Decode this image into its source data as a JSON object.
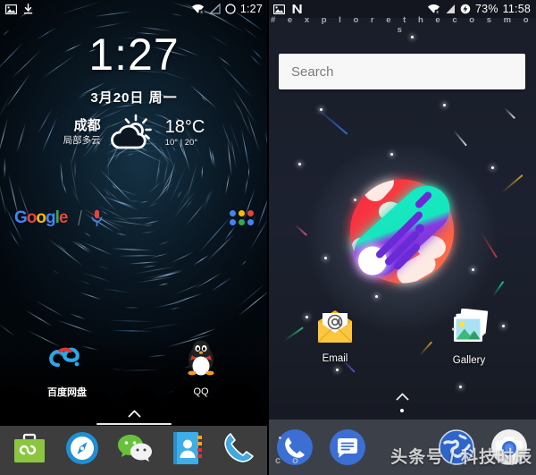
{
  "left_phone": {
    "status_bar": {
      "icons": [
        "image-icon",
        "download-icon"
      ],
      "wifi_icon": "wifi-off-icon",
      "signal_icon": "signal-no-service-icon",
      "battery_icon": "battery-empty-icon",
      "time": "1:27"
    },
    "clock_widget": {
      "time": "1:27",
      "date": "3月20日 周一",
      "weather": {
        "city": "成都",
        "condition": "局部多云",
        "icon": "partly-cloudy-icon",
        "temperature": "18°C",
        "range": "10° | 20°"
      }
    },
    "google_bar": {
      "logo": "Google",
      "logo_letters": [
        "G",
        "o",
        "o",
        "g",
        "l",
        "e"
      ],
      "mic_icon": "microphone-icon",
      "apps_icon": "colored-dots-grid-icon"
    },
    "home_apps": [
      {
        "label": "百度网盘",
        "icon": "baidu-netdisk-icon"
      },
      {
        "label": "QQ",
        "icon": "qq-penguin-icon"
      }
    ],
    "page_arrow": "^",
    "dock": [
      {
        "label": "Briefcase App",
        "icon": "green-briefcase-icon"
      },
      {
        "label": "Browser",
        "icon": "blue-compass-icon"
      },
      {
        "label": "WeChat",
        "icon": "wechat-icon"
      },
      {
        "label": "Contacts",
        "icon": "contacts-book-icon"
      },
      {
        "label": "Phone",
        "icon": "phone-handset-icon"
      }
    ]
  },
  "right_phone": {
    "status_bar": {
      "icons": [
        "image-icon",
        "nova-n-icon"
      ],
      "wifi_icon": "wifi-off-icon",
      "signal_icon": "signal-bars-icon",
      "battery_icon": "battery-charging-icon",
      "battery_percent": "73%",
      "time": "11:58"
    },
    "hashtag": "# e x p l o r e t h e c o s m o s",
    "search": {
      "placeholder": "Search",
      "value": ""
    },
    "hero": {
      "icon": "comet-planet-icon",
      "colors": {
        "comet_teal": "#12e8c0",
        "comet_purple": "#6b2fd6",
        "planet_red": "#f3273f",
        "planet_orange": "#ff6f4a"
      }
    },
    "home_apps": [
      {
        "label": "Email",
        "icon": "email-envelope-icon"
      },
      {
        "label": "Gallery",
        "icon": "gallery-photos-icon"
      }
    ],
    "page_arrow": "^",
    "dock": [
      {
        "label": "Phone",
        "icon": "phone-handset-icon"
      },
      {
        "label": "Messages",
        "icon": "messages-bubble-icon"
      },
      {
        "label": "Browser",
        "icon": "globe-browser-icon"
      },
      {
        "label": "Camera",
        "icon": "camera-icon"
      }
    ],
    "watermark": "头条号 / 科技时辰",
    "faint_text": "c o"
  },
  "colors": {
    "dock_bg_left": "#3d3d3d",
    "dock_bg_right": "#3c4049",
    "accent_blue": "#3b78e7",
    "google_blue": "#4285f4",
    "google_red": "#ea4335",
    "google_yellow": "#fbbc05",
    "google_green": "#34a853"
  }
}
